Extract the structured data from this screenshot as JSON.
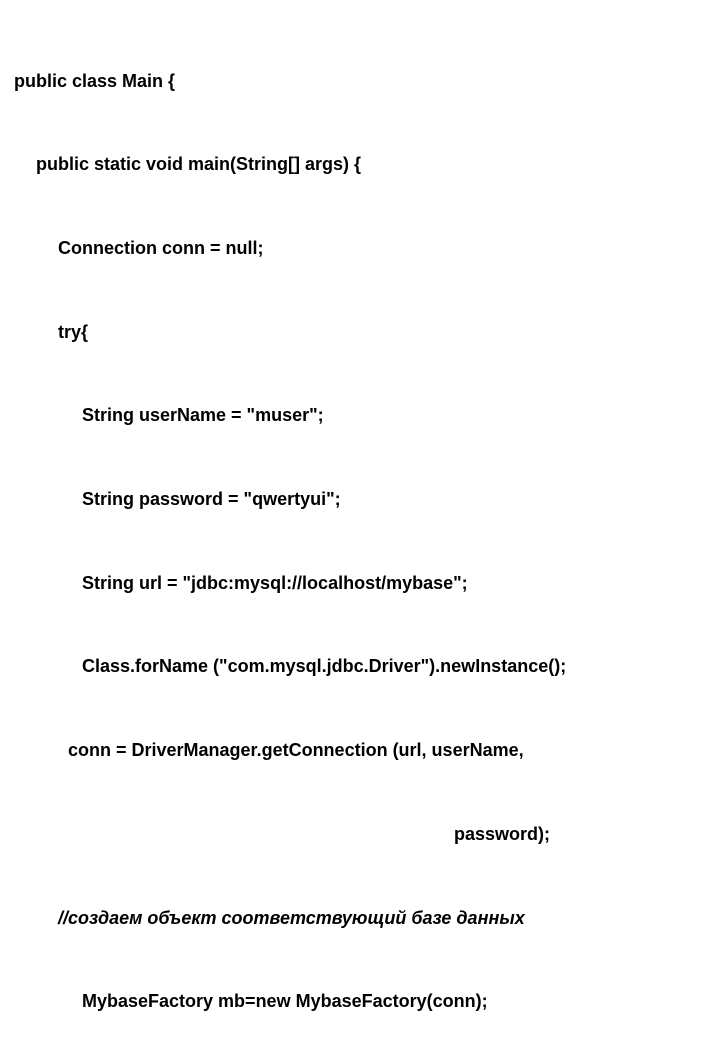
{
  "code": {
    "l0": "public class Main {",
    "l1": "public static void main(String[] args) {",
    "l2": "Connection conn = null;",
    "l3": "try{",
    "l4": "String userName = \"muser\";",
    "l5": "String password = \"qwertyui\";",
    "l6": "String url = \"jdbc:mysql://localhost/mybase\";",
    "l7": "Class.forName (\"com.mysql.jdbc.Driver\").newInstance();",
    "l8": "conn = DriverManager.getConnection (url, userName,",
    "l9": "password);",
    "l10": "//создаем объект соответствующий базе данных",
    "l11": "MybaseFactory mb=new MybaseFactory(conn);"
  }
}
